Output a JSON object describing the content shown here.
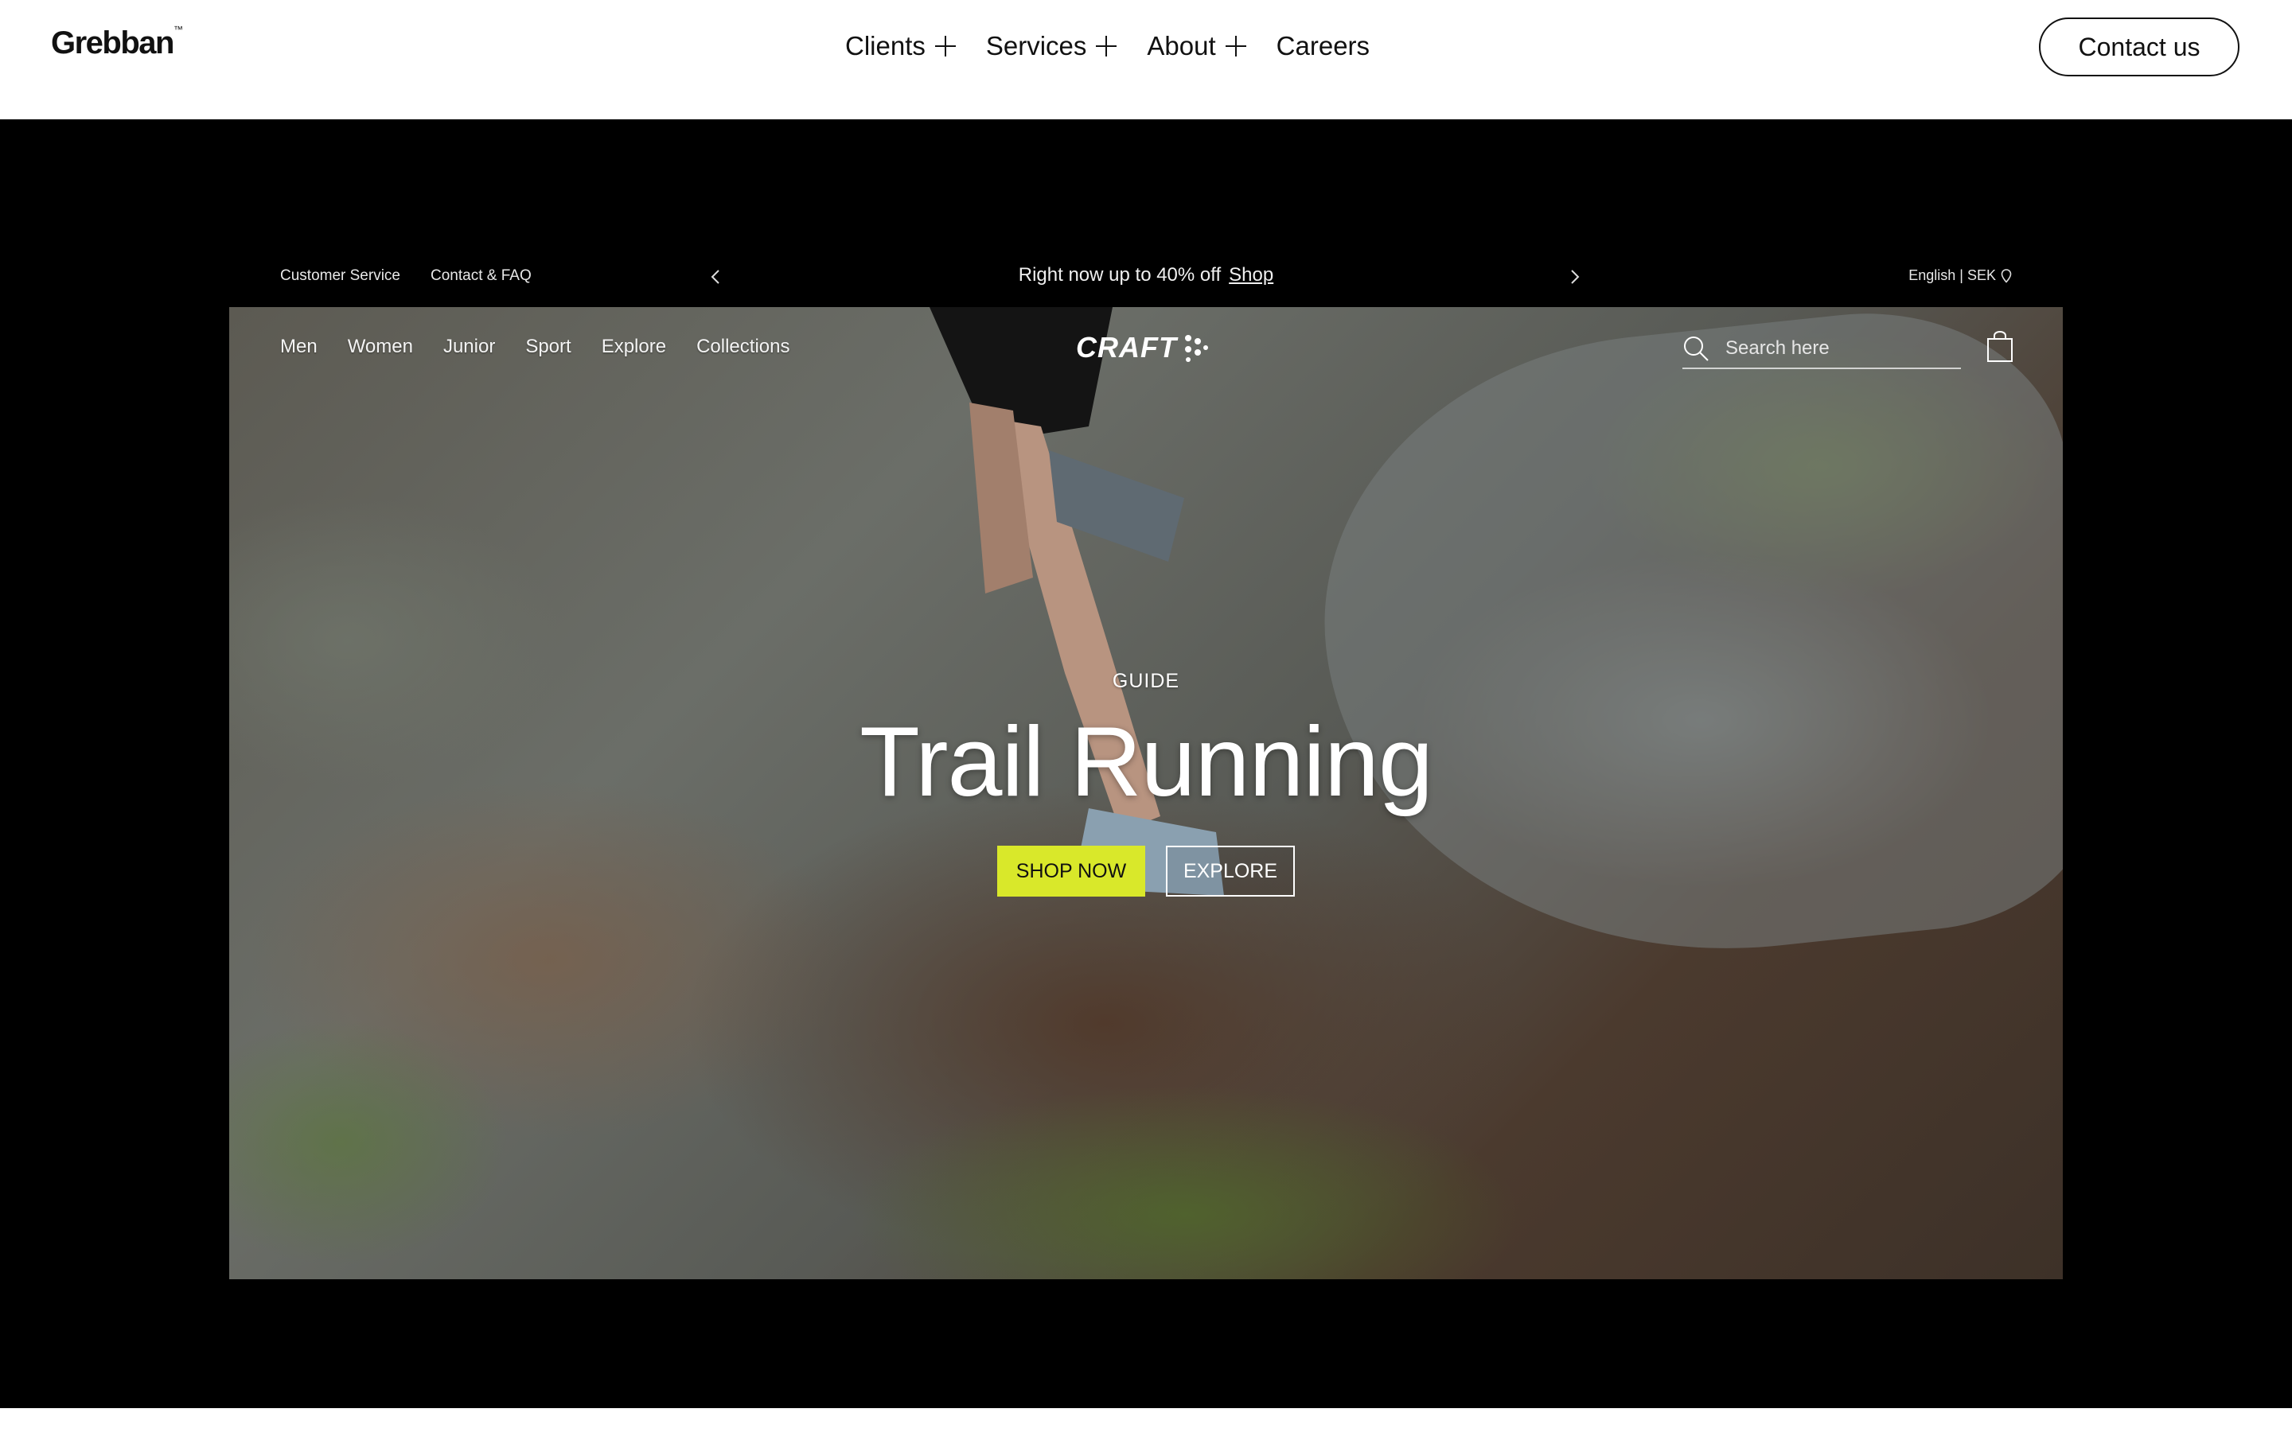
{
  "site": {
    "logo": "Grebban",
    "logo_mark": "™",
    "nav": [
      {
        "label": "Clients",
        "expandable": true
      },
      {
        "label": "Services",
        "expandable": true
      },
      {
        "label": "About",
        "expandable": true
      },
      {
        "label": "Careers",
        "expandable": false
      }
    ],
    "contact_label": "Contact us"
  },
  "showcase": {
    "announcement": {
      "customer_service": "Customer Service",
      "contact_faq": "Contact & FAQ",
      "promo_text": "Right now up to 40% off",
      "promo_link": "Shop",
      "language": "English | SEK"
    },
    "store_nav": [
      "Men",
      "Women",
      "Junior",
      "Sport",
      "Explore",
      "Collections"
    ],
    "brand_logo": "CRAFT",
    "search_placeholder": "Search here",
    "hero": {
      "eyebrow": "GUIDE",
      "title": "Trail Running",
      "primary_cta": "SHOP NOW",
      "secondary_cta": "EXPLORE"
    },
    "colors": {
      "cta_accent": "#d9e82a",
      "page_background": "#000000",
      "header_background": "#ffffff"
    }
  }
}
